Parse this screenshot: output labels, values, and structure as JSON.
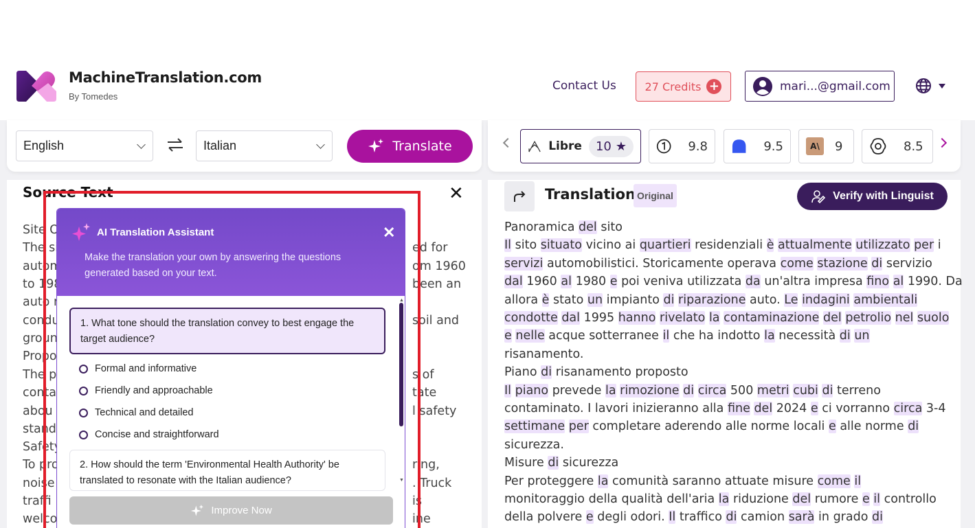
{
  "brand": {
    "name": "MachineTranslation.com",
    "sub": "By Tomedes"
  },
  "header": {
    "contact": "Contact Us",
    "credits": "27 Credits",
    "account": "mari...@gmail.com",
    "icons": {
      "globe": "globe-icon",
      "caret": "caret-down-icon",
      "plus": "plus-icon",
      "user": "user-icon"
    }
  },
  "toolbar": {
    "source_lang": "English",
    "target_lang": "Italian",
    "translate_label": "Translate"
  },
  "engines": [
    {
      "name": "Libre",
      "score": "10",
      "selected": true
    },
    {
      "name": "",
      "score": "9.8"
    },
    {
      "name": "",
      "score": "9.5"
    },
    {
      "name": "",
      "score": "9"
    },
    {
      "name": "",
      "score": "8.5"
    }
  ],
  "source": {
    "title": "Source Text",
    "lines_left": [
      "Site O",
      "The si",
      "autom",
      "to 198",
      "auto r",
      "condu",
      "groun",
      "Propo",
      "The p",
      "conta",
      "abou",
      "stand",
      "Safety",
      "To pro",
      "noise",
      "traffi",
      "welco"
    ],
    "lines_right": [
      "ed for",
      "om 1960",
      "been an",
      "soil and",
      "s of",
      "tate",
      "l safety",
      "ring,",
      ". Truck",
      "is",
      "ine"
    ]
  },
  "assistant": {
    "title": "AI Translation Assistant",
    "description": "Make the translation your own by answering the questions generated based on your text.",
    "question1": "1. What tone should the translation convey to best engage the target audience?",
    "options": [
      "Formal and informative",
      "Friendly and approachable",
      "Technical and detailed",
      "Concise and straightforward"
    ],
    "question2": "2. How should the term 'Environmental Health Authority' be translated to resonate with the Italian audience?",
    "improve_label": "Improve Now"
  },
  "translation": {
    "title": "Translation",
    "badge": "Original",
    "verify_label": "Verify with Linguist",
    "lines": [
      "Panoramica del sito",
      "Il sito situato vicino ai quartieri residenziali è attualmente utilizzato per i",
      "servizi automobilistici. Storicamente operava come stazione di servizio",
      "dal 1960 al 1980 e poi veniva utilizzata da un'altra impresa fino al 1990. Da",
      "allora è stato un impianto di riparazione auto. Le indagini ambientali",
      "condotte dal 1995 hanno rivelato la contaminazione del petrolio nel suolo",
      "e nelle acque sotterranee il che ha indotto la necessità di un",
      "risanamento.",
      "Piano di risanamento proposto",
      "Il piano prevede la rimozione di circa 500 metri cubi di terreno",
      "contaminato. I lavori inizieranno alla fine del 2024 e ci vorranno circa 3-4",
      "settimane per completare aderendo alle norme locali e alle norme di",
      "sicurezza.",
      "Misure di sicurezza",
      "Per proteggere la comunità saranno attuate misure come il",
      "monitoraggio della qualità dell'aria la riduzione del rumore e il controllo",
      "della polvere e degli odori. Il traffico di camion sarà in grado di"
    ],
    "highlight_words": [
      "del",
      "situato",
      "quartieri",
      "è",
      "attualmente",
      "utilizzato",
      "per",
      "servizi",
      "come",
      "stazione",
      "di",
      "dal",
      "al",
      "e",
      "da",
      "fino",
      "un",
      "riparazione",
      "Le",
      "indagini",
      "ambientali",
      "condotte",
      "hanno",
      "rivelato",
      "la",
      "contaminazione",
      "petrolio",
      "nel",
      "suolo",
      "nelle",
      "il",
      "piano",
      "rimozione",
      "circa",
      "metri",
      "cubi",
      "fine",
      "settimane",
      "sarà",
      "Il"
    ]
  }
}
